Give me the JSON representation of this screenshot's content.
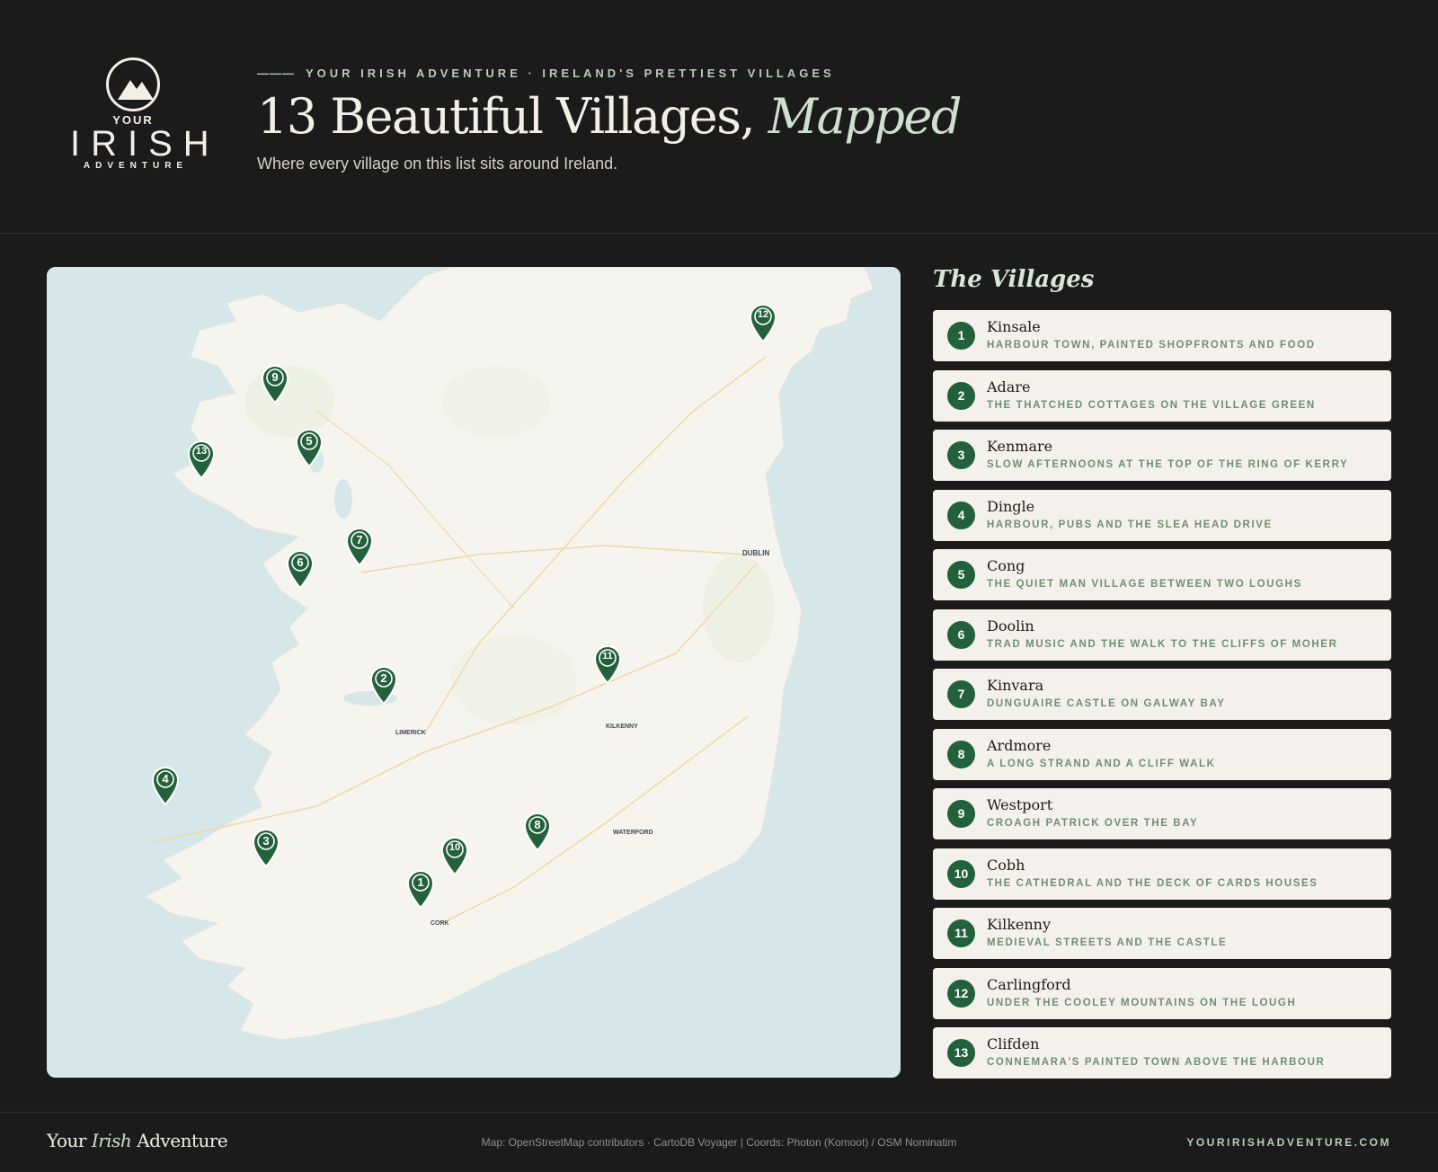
{
  "logo": {
    "your": "YOUR",
    "irish": "IRISH",
    "adventure": "ADVENTURE"
  },
  "header": {
    "eyebrow_dash": "———",
    "eyebrow": "YOUR IRISH ADVENTURE · IRELAND'S PRETTIEST VILLAGES",
    "title_main": "13 Beautiful Villages,",
    "title_em": "Mapped",
    "subtitle": "Where every village on this list sits around Ireland."
  },
  "map": {
    "city_labels": [
      "DUBLIN",
      "KILKENNY",
      "WATERFORD",
      "CORK",
      "LIMERICK"
    ]
  },
  "list": {
    "heading": "The Villages",
    "items": [
      {
        "num": "1",
        "name": "Kinsale",
        "desc": "HARBOUR TOWN, PAINTED SHOPFRONTS AND FOOD"
      },
      {
        "num": "2",
        "name": "Adare",
        "desc": "THE THATCHED COTTAGES ON THE VILLAGE GREEN"
      },
      {
        "num": "3",
        "name": "Kenmare",
        "desc": "SLOW AFTERNOONS AT THE TOP OF THE RING OF KERRY"
      },
      {
        "num": "4",
        "name": "Dingle",
        "desc": "HARBOUR, PUBS AND THE SLEA HEAD DRIVE"
      },
      {
        "num": "5",
        "name": "Cong",
        "desc": "THE QUIET MAN VILLAGE BETWEEN TWO LOUGHS"
      },
      {
        "num": "6",
        "name": "Doolin",
        "desc": "TRAD MUSIC AND THE WALK TO THE CLIFFS OF MOHER"
      },
      {
        "num": "7",
        "name": "Kinvara",
        "desc": "DUNGUAIRE CASTLE ON GALWAY BAY"
      },
      {
        "num": "8",
        "name": "Ardmore",
        "desc": "A LONG STRAND AND A CLIFF WALK"
      },
      {
        "num": "9",
        "name": "Westport",
        "desc": "CROAGH PATRICK OVER THE BAY"
      },
      {
        "num": "10",
        "name": "Cobh",
        "desc": "THE CATHEDRAL AND THE DECK OF CARDS HOUSES"
      },
      {
        "num": "11",
        "name": "Kilkenny",
        "desc": "MEDIEVAL STREETS AND THE CASTLE"
      },
      {
        "num": "12",
        "name": "Carlingford",
        "desc": "UNDER THE COOLEY MOUNTAINS ON THE LOUGH"
      },
      {
        "num": "13",
        "name": "Clifden",
        "desc": "CONNEMARA'S PAINTED TOWN ABOVE THE HARBOUR"
      }
    ]
  },
  "footer": {
    "brand_pre": "Your",
    "brand_em": "Irish",
    "brand_post": "Adventure",
    "credits": "Map: OpenStreetMap contributors · CartoDB Voyager | Coords: Photon (Komoot) / OSM Nominatim",
    "site": "YOURIRISHADVENTURE.COM"
  },
  "colors": {
    "accent": "#22613c",
    "background": "#1b1b1b",
    "card": "#f4f1ec",
    "sea": "#d6e7ea",
    "land": "#f6f4ee"
  }
}
